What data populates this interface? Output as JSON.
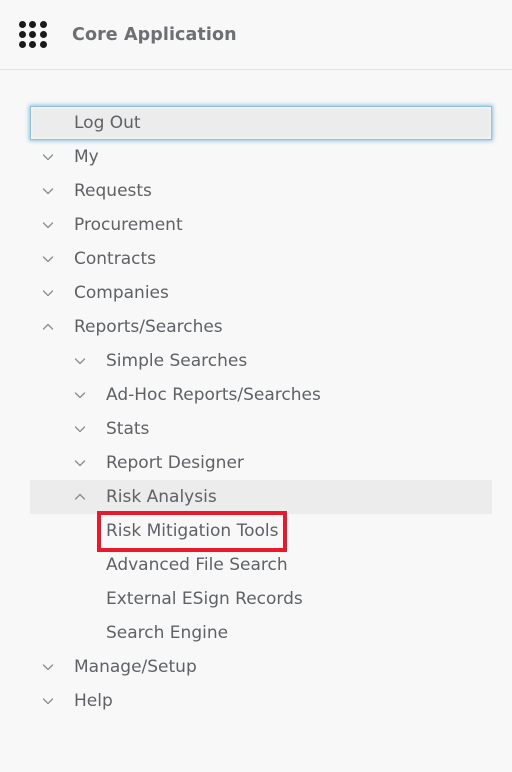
{
  "header": {
    "app_icon": "grid-3x3-icon",
    "title": "Core Application"
  },
  "colors": {
    "page_background": "#f8f8f8",
    "row_highlight": "#ececec",
    "focus_ring": "#8ec2dd",
    "annotation_red": "#e8192b",
    "label_text": "#5e6165",
    "title_text": "#6c6f74",
    "divider": "#e4e4e4"
  },
  "nav": {
    "items": [
      {
        "label": "Log Out",
        "level": 1,
        "chevron": "none",
        "state": "focused"
      },
      {
        "label": "My",
        "level": 1,
        "chevron": "down",
        "state": "normal"
      },
      {
        "label": "Requests",
        "level": 1,
        "chevron": "down",
        "state": "normal"
      },
      {
        "label": "Procurement",
        "level": 1,
        "chevron": "down",
        "state": "normal"
      },
      {
        "label": "Contracts",
        "level": 1,
        "chevron": "down",
        "state": "normal"
      },
      {
        "label": "Companies",
        "level": 1,
        "chevron": "down",
        "state": "normal"
      },
      {
        "label": "Reports/Searches",
        "level": 1,
        "chevron": "up",
        "state": "normal"
      },
      {
        "label": "Simple Searches",
        "level": 2,
        "chevron": "down",
        "state": "normal"
      },
      {
        "label": "Ad-Hoc Reports/Searches",
        "level": 2,
        "chevron": "down",
        "state": "normal"
      },
      {
        "label": "Stats",
        "level": 2,
        "chevron": "down",
        "state": "normal"
      },
      {
        "label": "Report Designer",
        "level": 2,
        "chevron": "down",
        "state": "normal"
      },
      {
        "label": "Risk Analysis",
        "level": 2,
        "chevron": "up",
        "state": "highlighted"
      },
      {
        "label": "Risk Mitigation Tools",
        "level": 3,
        "chevron": "none",
        "state": "annotated"
      },
      {
        "label": "Advanced File Search",
        "level": 3,
        "chevron": "none",
        "state": "normal"
      },
      {
        "label": "External ESign Records",
        "level": 3,
        "chevron": "none",
        "state": "normal"
      },
      {
        "label": "Search Engine",
        "level": 3,
        "chevron": "none",
        "state": "normal"
      },
      {
        "label": "Manage/Setup",
        "level": 1,
        "chevron": "down",
        "state": "normal"
      },
      {
        "label": "Help",
        "level": 1,
        "chevron": "down",
        "state": "normal"
      }
    ]
  },
  "annotation": {
    "target_label": "Risk Mitigation Tools",
    "shape": "rectangle",
    "color": "#e8192b"
  }
}
